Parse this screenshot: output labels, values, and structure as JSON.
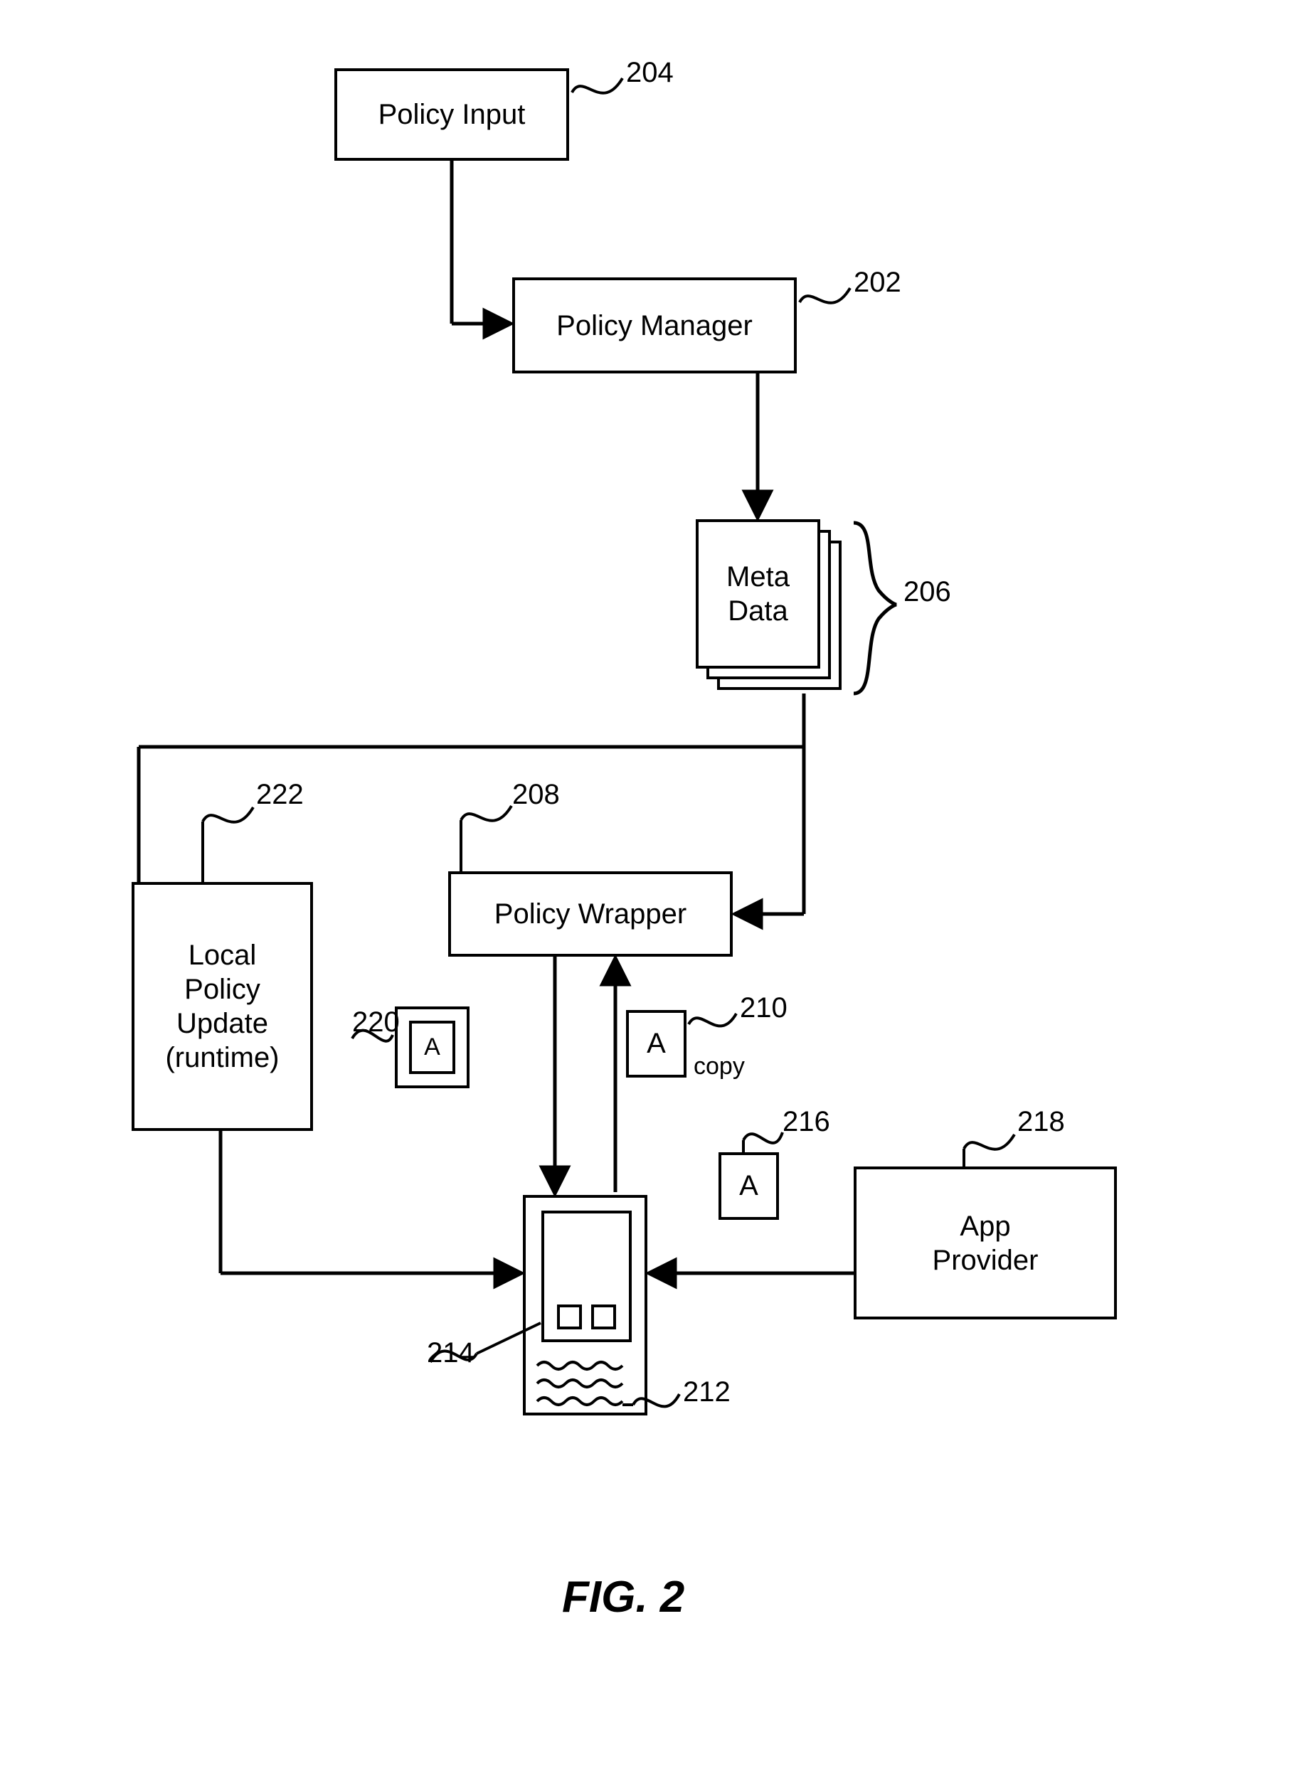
{
  "figure_label": "FIG. 2",
  "boxes": {
    "policy_input": {
      "label": "Policy Input",
      "ref": "204"
    },
    "policy_manager": {
      "label": "Policy Manager",
      "ref": "202"
    },
    "meta_data": {
      "label": "Meta\nData",
      "ref": "206"
    },
    "policy_wrapper": {
      "label": "Policy Wrapper",
      "ref": "208"
    },
    "local_policy_update": {
      "label": "Local\nPolicy\nUpdate\n(runtime)",
      "ref": "222"
    },
    "app_provider": {
      "label": "App\nProvider",
      "ref": "218"
    }
  },
  "icons": {
    "wrapped_app": {
      "letter": "A",
      "ref": "220"
    },
    "app_copy": {
      "letter": "A",
      "copy_label": "copy",
      "ref": "210"
    },
    "downloaded_app": {
      "letter": "A",
      "ref": "216"
    }
  },
  "device": {
    "ref": "212",
    "screen_ref": "214"
  }
}
